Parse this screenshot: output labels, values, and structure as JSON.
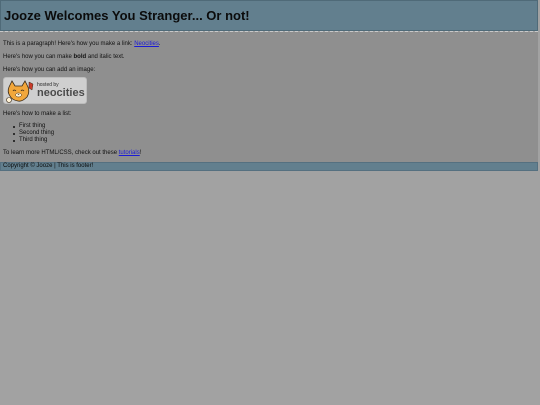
{
  "header": {
    "title": "Jooze Welcomes You Stranger... Or not!"
  },
  "main": {
    "p1_text": "This is a paragraph! Here's how you make a link: ",
    "p1_link": "Neocities",
    "p1_end": ".",
    "p2_before": "Here's how you can make ",
    "p2_bold": "bold",
    "p2_after": " and italic text.",
    "p3": "Here's how you can add an image:",
    "badge": {
      "hosted": "hosted by",
      "brand": "neocities",
      "icon": "neocities-cat-icon"
    },
    "p4": "Here's how to make a list:",
    "list": [
      "First thing",
      "Second thing",
      "Third thing"
    ],
    "p5_before": "To learn more HTML/CSS, check out these ",
    "p5_link": "tutorials",
    "p5_after": "!"
  },
  "footer": {
    "text": "Copyright © Jooze | This is footer!"
  },
  "colors": {
    "header": "#627f8e",
    "main": "#8f8f8f",
    "page": "#a2a2a2",
    "link": "#1a1ad6"
  }
}
